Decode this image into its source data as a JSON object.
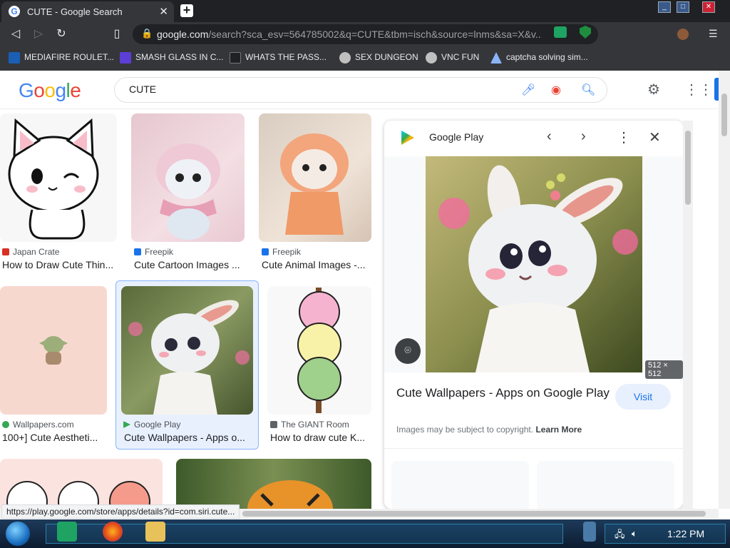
{
  "browser": {
    "tab_title": "CUTE - Google Search",
    "url_domain": "google.com",
    "url_rest": "/search?sca_esv=564785002&q=CUTE&tbm=isch&source=lnms&sa=X&v...",
    "bookmarks": [
      {
        "label": "MEDIAFIRE ROULET...",
        "icon_color": "#1a5fb4"
      },
      {
        "label": "SMASH GLASS IN C...",
        "icon_color": "#5b3fd6"
      },
      {
        "label": "WHATS THE PASS...",
        "icon_color": "#202124"
      },
      {
        "label": "SEX DUNGEON",
        "icon_color": "#c0c0c0"
      },
      {
        "label": "VNC FUN",
        "icon_color": "#c0c0c0"
      },
      {
        "label": "captcha solving sim...",
        "icon_color": "#8ab4f8"
      }
    ]
  },
  "search": {
    "query": "CUTE"
  },
  "results": [
    {
      "source": "Japan Crate",
      "title": "How to Draw Cute Thin...",
      "icon_color": "#d93025"
    },
    {
      "source": "Freepik",
      "title": "Cute Cartoon Images ...",
      "icon_color": "#1a73e8"
    },
    {
      "source": "Freepik",
      "title": "Cute Animal Images -...",
      "icon_color": "#1a73e8"
    },
    {
      "source": "Wallpapers.com",
      "title": "100+] Cute Aestheti...",
      "icon_color": "#34a853"
    },
    {
      "source": "Google Play",
      "title": "Cute Wallpapers - Apps o...",
      "icon_color": "#34a853"
    },
    {
      "source": "The GIANT Room",
      "title": "How to draw cute K...",
      "icon_color": "#5f6368"
    }
  ],
  "panel": {
    "site": "Google Play",
    "dimensions": "512 × 512",
    "title": "Cute Wallpapers - Apps on Google Play",
    "visit": "Visit",
    "copyright": "Images may be subject to copyright.",
    "learn_more": "Learn More"
  },
  "status_url": "https://play.google.com/store/apps/details?id=com.siri.cute...",
  "taskbar": {
    "time": "1:22 PM"
  }
}
